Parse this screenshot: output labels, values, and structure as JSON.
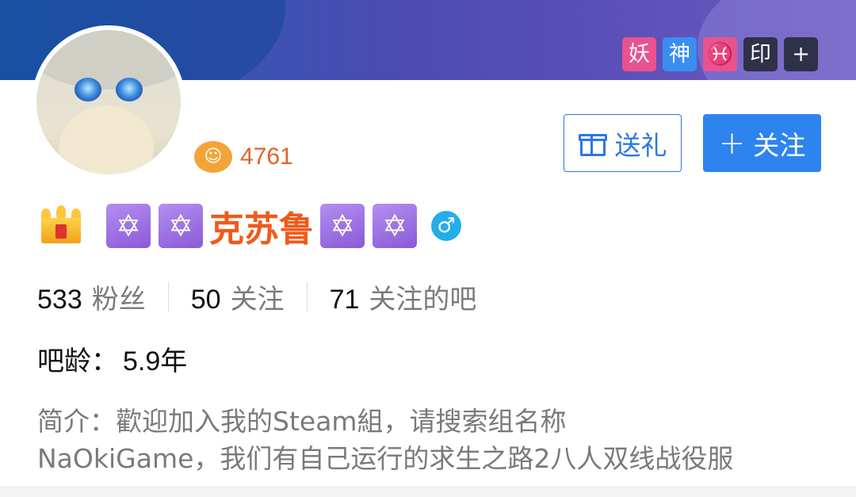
{
  "header": {
    "badges": [
      {
        "text": "妖",
        "color": "#e8528e"
      },
      {
        "text": "神",
        "color": "#3a8ef0"
      },
      {
        "text": "♓",
        "color": "#e8528e"
      },
      {
        "text": "印",
        "color": "#2e3147"
      },
      {
        "text": "+",
        "color": "#2e3147"
      }
    ]
  },
  "profile": {
    "level_value": "4761",
    "username": "克苏鲁",
    "gender_icon": "male-symbol",
    "hex_symbol": "✡"
  },
  "actions": {
    "gift_label": "送礼",
    "follow_label": "关注",
    "follow_plus": "+"
  },
  "stats": [
    {
      "num": "533",
      "label": "粉丝"
    },
    {
      "num": "50",
      "label": "关注"
    },
    {
      "num": "71",
      "label": "关注的吧"
    }
  ],
  "age": {
    "label": "吧龄：",
    "value": "5.9年"
  },
  "bio": {
    "line1": "简介：歡迎加入我的Steam組，请搜索组名称",
    "line2": "NaOkiGame，我们有自己运行的求生之路2八人双线战役服"
  },
  "colors": {
    "accent": "#2e84ef",
    "username": "#f05a1a",
    "level": "#e0632a"
  }
}
